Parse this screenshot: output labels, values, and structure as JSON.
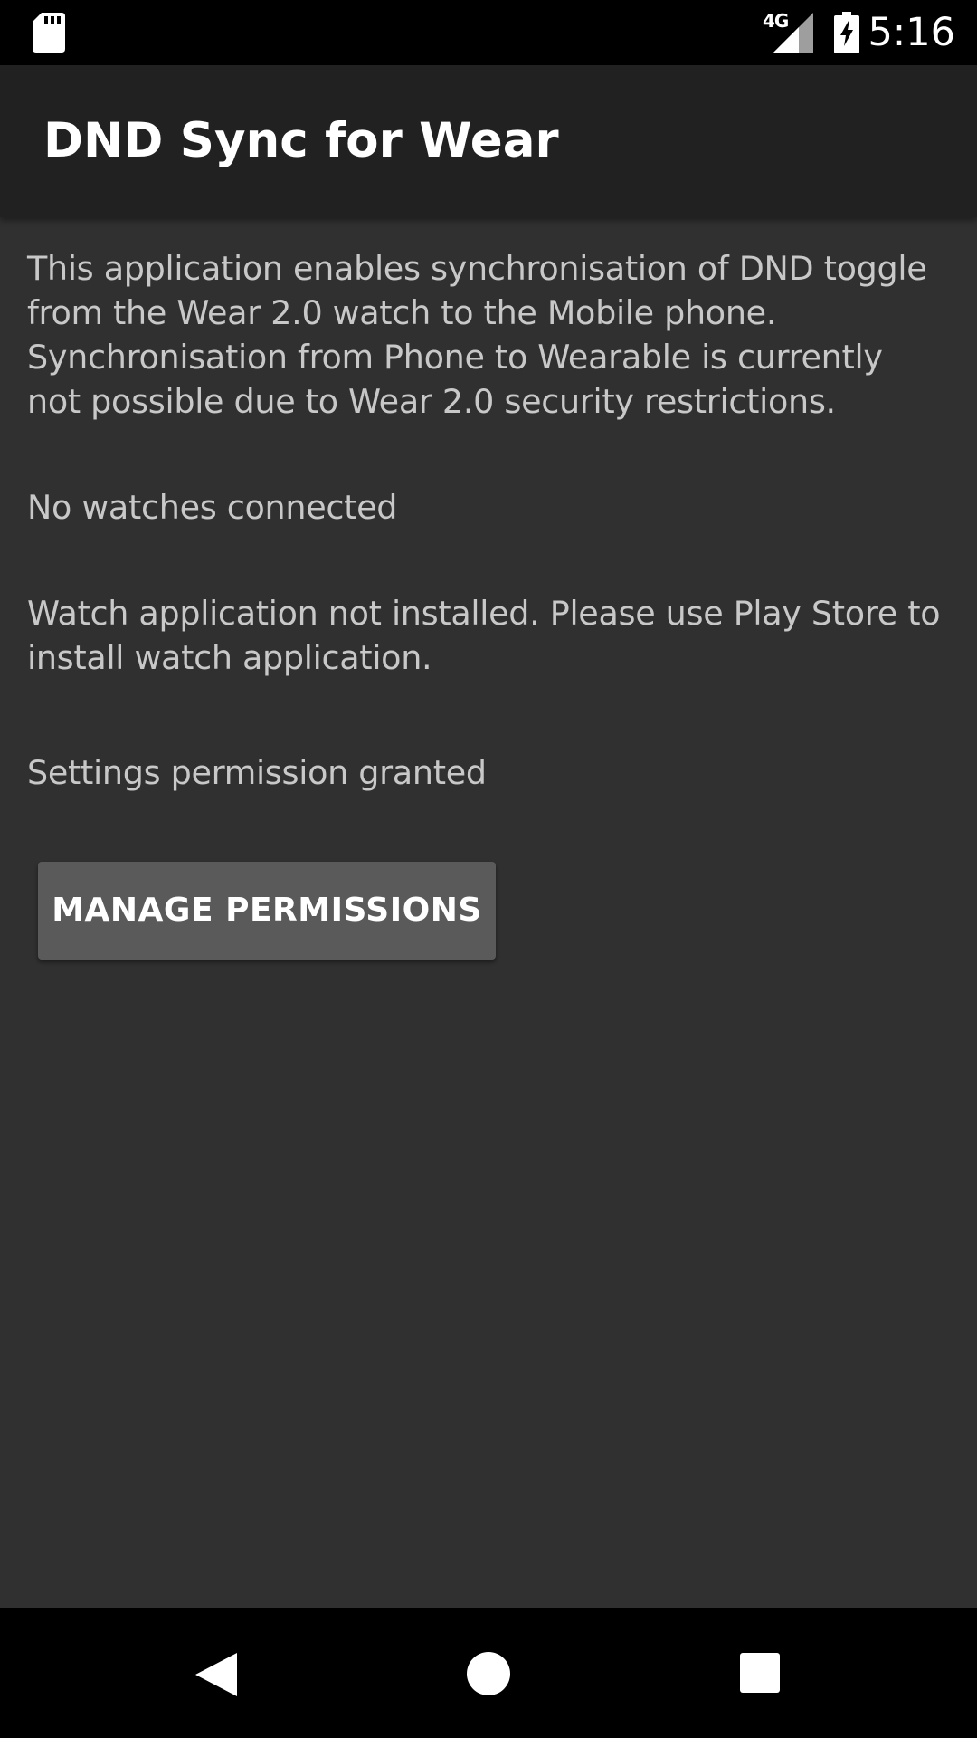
{
  "status_bar": {
    "network": "4G",
    "time": "5:16",
    "icons": [
      "sd-card-icon",
      "cellular-signal-icon",
      "battery-charging-icon"
    ]
  },
  "app_bar": {
    "title": "DND Sync for Wear"
  },
  "content": {
    "description": "This application enables synchronisation of DND toggle from the Wear 2.0 watch to the Mobile phone. Synchronisation from Phone to Wearable is currently not possible due to Wear 2.0 security restrictions.",
    "watches_status": "No watches connected",
    "install_status": "Watch application not installed. Please use Play Store to install watch application.",
    "settings_status": "Settings permission granted",
    "manage_button_label": "MANAGE PERMISSIONS"
  },
  "nav_bar": {
    "icons": [
      "back-icon",
      "home-icon",
      "recents-icon"
    ]
  },
  "colors": {
    "background": "#303030",
    "app_bar": "#212121",
    "status_bar": "#000000",
    "text_secondary": "#c8c8c8",
    "button": "#5a5a5a"
  }
}
